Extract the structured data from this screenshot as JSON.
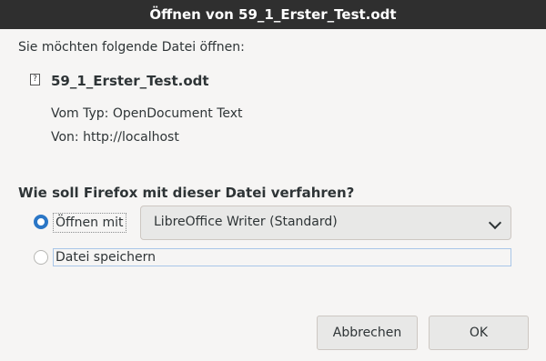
{
  "window": {
    "title": "Öffnen von 59_1_Erster_Test.odt"
  },
  "intro": "Sie möchten folgende Datei öffnen:",
  "file": {
    "icon": "unknown-file-icon",
    "icon_glyph": "?",
    "name": "59_1_Erster_Test.odt",
    "type_line": "Vom Typ: OpenDocument Text",
    "from_line": "Von: http://localhost"
  },
  "question": "Wie soll Firefox mit dieser Datei verfahren?",
  "options": {
    "open_with": {
      "label": "Öffnen mit",
      "checked": true
    },
    "app_select": {
      "value": "LibreOffice Writer (Standard)"
    },
    "save_file": {
      "label": "Datei speichern",
      "checked": false
    }
  },
  "buttons": {
    "cancel": "Abbrechen",
    "ok": "OK"
  },
  "colors": {
    "titlebar": "#2f2f2f",
    "accent": "#2a76c6",
    "background": "#f6f5f4"
  }
}
